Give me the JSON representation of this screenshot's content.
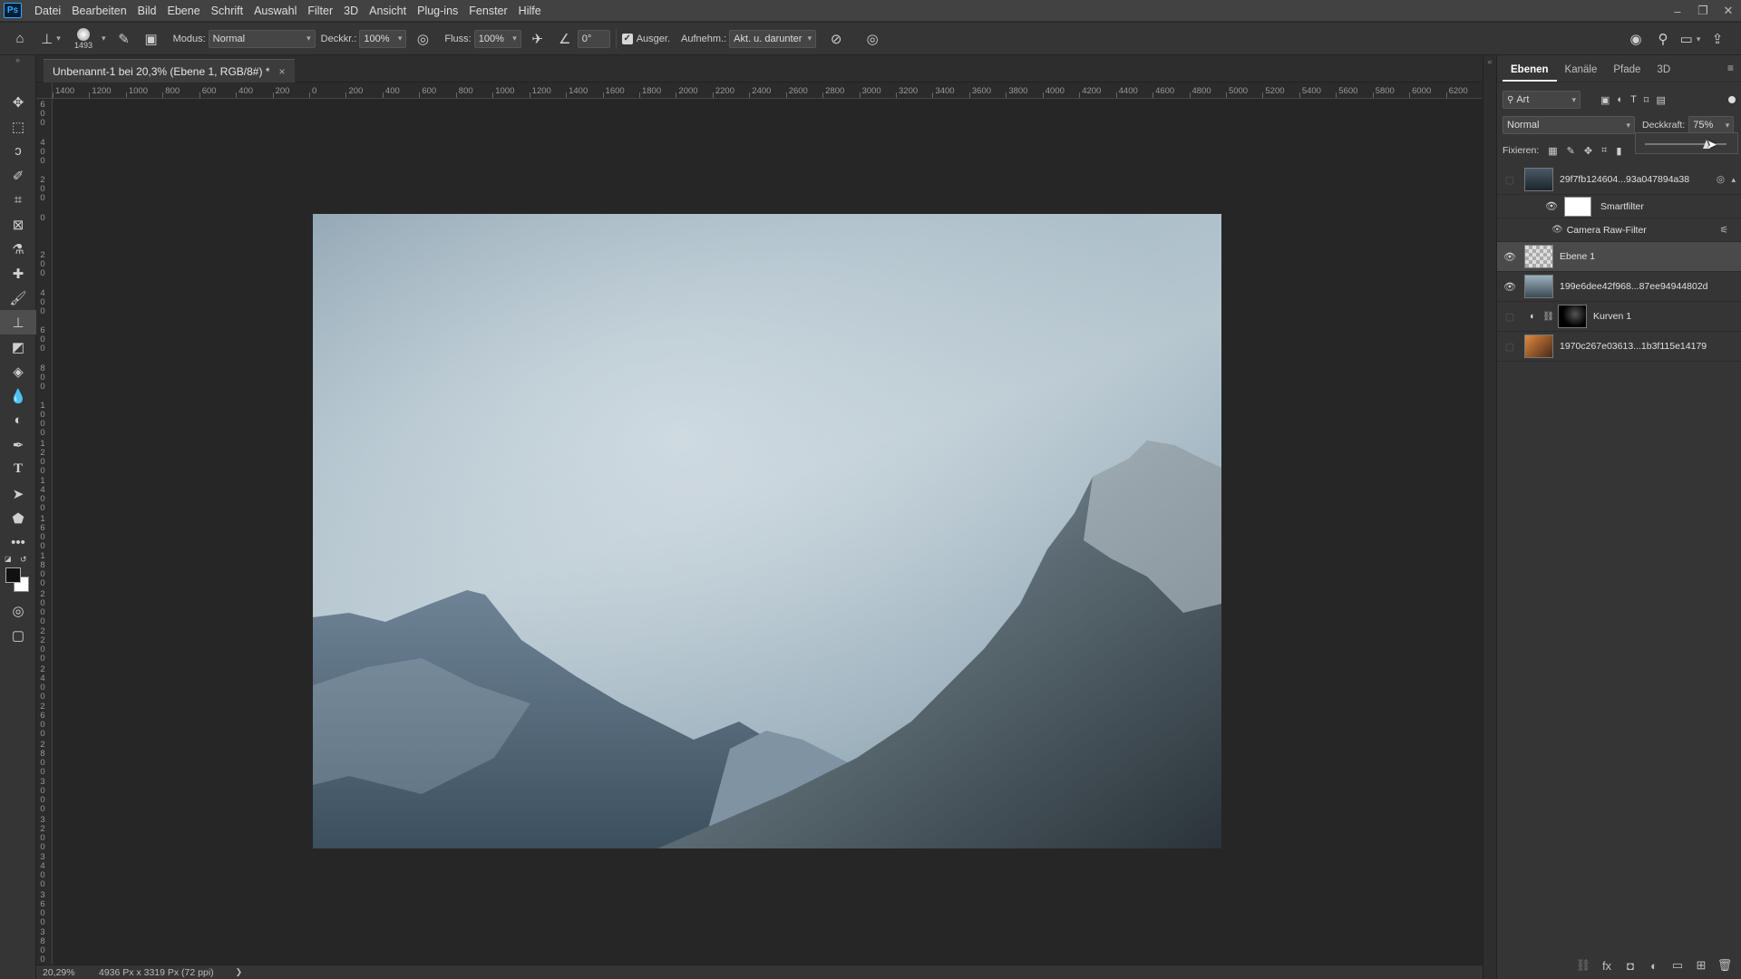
{
  "menubar": {
    "logo": "Ps",
    "items": [
      "Datei",
      "Bearbeiten",
      "Bild",
      "Ebene",
      "Schrift",
      "Auswahl",
      "Filter",
      "3D",
      "Ansicht",
      "Plug-ins",
      "Fenster",
      "Hilfe"
    ]
  },
  "options": {
    "brush_size": "1493",
    "modus_label": "Modus:",
    "modus_value": "Normal",
    "deckkraft_label": "Deckkr.:",
    "deckkraft_value": "100%",
    "fluss_label": "Fluss:",
    "fluss_value": "100%",
    "angle_value": "0°",
    "ausger_label": "Ausger.",
    "aufnehm_label": "Aufnehm.:",
    "aufnehm_value": "Akt. u. darunter"
  },
  "document": {
    "tab_title": "Unbenannt-1 bei 20,3% (Ebene 1, RGB/8#) *"
  },
  "rulers": {
    "horizontal": [
      "1400",
      "1200",
      "1000",
      "800",
      "600",
      "400",
      "200",
      "0",
      "200",
      "400",
      "600",
      "800",
      "1000",
      "1200",
      "1400",
      "1600",
      "1800",
      "2000",
      "2200",
      "2400",
      "2600",
      "2800",
      "3000",
      "3200",
      "3400",
      "3600",
      "3800",
      "4000",
      "4200",
      "4400",
      "4600",
      "4800",
      "5000",
      "5200",
      "5400",
      "5600",
      "5800",
      "6000",
      "6200"
    ],
    "vertical": [
      "600",
      "400",
      "200",
      "0",
      "200",
      "400",
      "600",
      "800",
      "1000",
      "1200",
      "1400",
      "1600",
      "1800",
      "2000",
      "2200",
      "2400",
      "2600",
      "2800",
      "3000",
      "3200",
      "3400",
      "3600",
      "3800"
    ]
  },
  "status": {
    "zoom": "20,29%",
    "doc_size": "4936 Px x 3319 Px (72 ppi)",
    "arrow": "❯"
  },
  "panel": {
    "tabs": [
      "Ebenen",
      "Kanäle",
      "Pfade",
      "3D"
    ],
    "filter_value": "Art",
    "blend_mode": "Normal",
    "opacity_label": "Deckkraft:",
    "opacity_value": "75%",
    "lock_label": "Fixieren:",
    "layers": [
      {
        "name": "29f7fb124604...93a047894a38",
        "visible": false
      },
      {
        "name": "Smartfilter",
        "visible": true
      },
      {
        "name": "Camera Raw-Filter",
        "visible": true
      },
      {
        "name": "Ebene 1",
        "visible": true,
        "selected": true
      },
      {
        "name": "199e6dee42f968...87ee94944802d",
        "visible": true
      },
      {
        "name": "Kurven 1",
        "visible": false
      },
      {
        "name": "1970c267e03613...1b3f115e14179",
        "visible": false
      }
    ]
  },
  "colors": {
    "accent": "#31a8ff",
    "foreground": "#111111",
    "background": "#ffffff"
  }
}
